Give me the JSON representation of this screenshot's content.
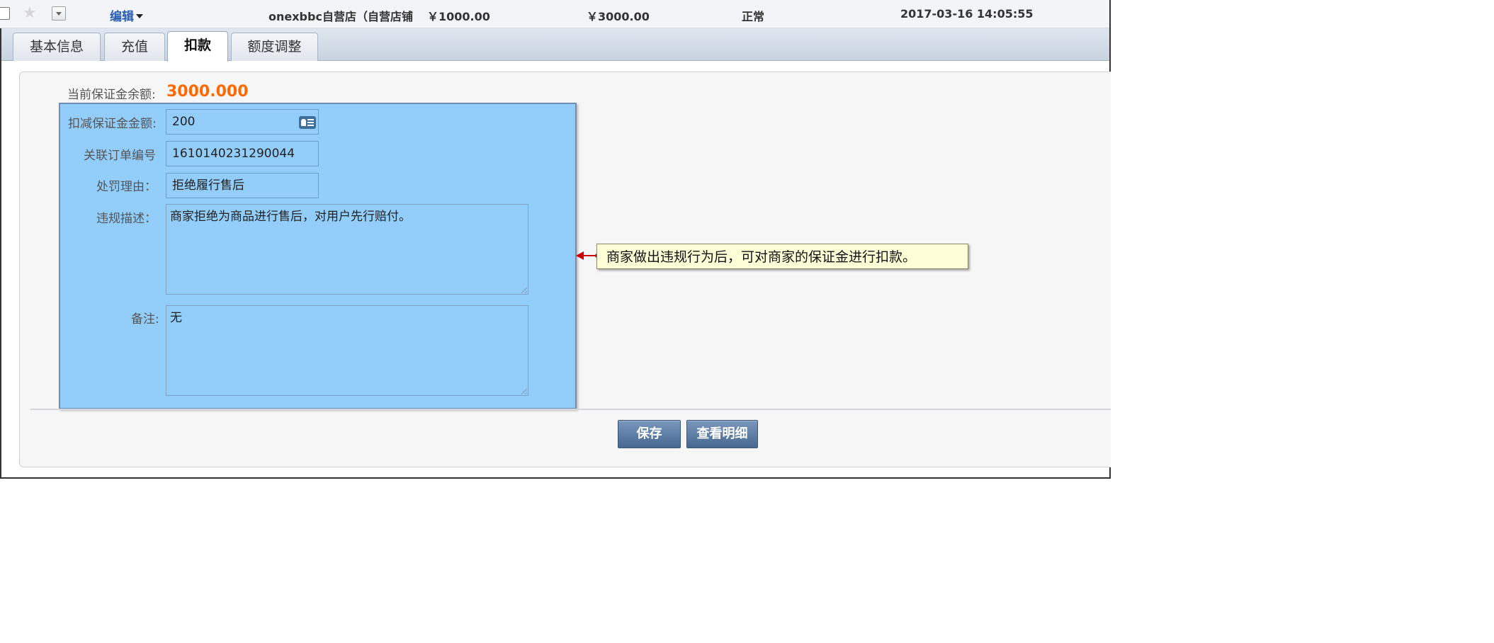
{
  "record": {
    "edit_label": "编辑",
    "shop_name": "onexbbc自营店（自营店铺",
    "amount_a": "￥1000.00",
    "amount_b": "￥3000.00",
    "status": "正常",
    "datetime": "2017-03-16 14:05:55"
  },
  "tabs": [
    {
      "label": "基本信息",
      "active": false
    },
    {
      "label": "充值",
      "active": false
    },
    {
      "label": "扣款",
      "active": true
    },
    {
      "label": "额度调整",
      "active": false
    }
  ],
  "form": {
    "balance_label": "当前保证金余额:",
    "balance_value": "3000.000",
    "deduct_amount": {
      "label": "扣减保证金金额:",
      "value": "200"
    },
    "order_no": {
      "label": "关联订单编号",
      "value": "1610140231290044"
    },
    "reason": {
      "label": "处罚理由：",
      "value": "拒绝履行售后"
    },
    "violation": {
      "label": "违规描述：",
      "value": "商家拒绝为商品进行售后，对用户先行赔付。"
    },
    "remark": {
      "label": "备注:",
      "value": "无"
    }
  },
  "buttons": {
    "save": "保存",
    "view_details": "查看明细"
  },
  "callout": {
    "text": "商家做出违规行为后，可对商家的保证金进行扣款。"
  },
  "colors": {
    "balance": "#ff6a00",
    "highlight": "#64b9fa",
    "link": "#2a5db0",
    "button": "#46688f",
    "callout_bg": "#ffffd7"
  },
  "icons": [
    "checkbox-icon",
    "star-icon",
    "dropdown-icon",
    "caret-down-icon",
    "id-card-icon",
    "resize-grip-icon",
    "arrow-left-icon"
  ]
}
